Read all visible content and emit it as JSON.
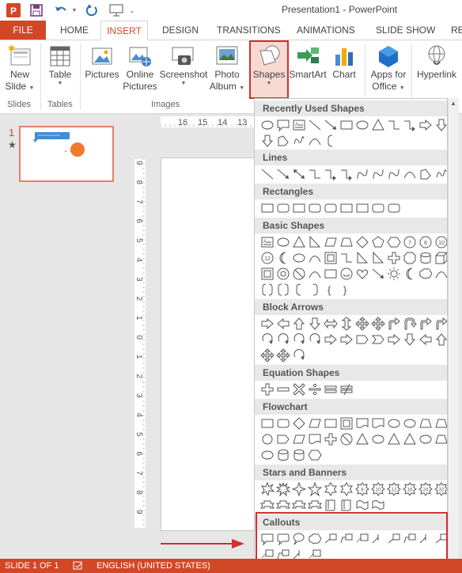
{
  "window": {
    "title": "Presentation1 - PowerPoint"
  },
  "tabs": [
    "FILE",
    "HOME",
    "INSERT",
    "DESIGN",
    "TRANSITIONS",
    "ANIMATIONS",
    "SLIDE SHOW",
    "RE"
  ],
  "ribbon": {
    "new_slide": [
      "New",
      "Slide"
    ],
    "table": "Table",
    "pictures": "Pictures",
    "online_pictures": [
      "Online",
      "Pictures"
    ],
    "screenshot": "Screenshot",
    "photo_album": [
      "Photo",
      "Album"
    ],
    "shapes": "Shapes",
    "smartart": "SmartArt",
    "chart": "Chart",
    "apps_office": [
      "Apps for",
      "Office"
    ],
    "hyperlink": "Hyperlink",
    "groups": {
      "slides": "Slides",
      "tables": "Tables",
      "images": "Images"
    }
  },
  "slides_pane": {
    "num": "1",
    "star": "★"
  },
  "ruler": {
    "ticks": [
      "16",
      "15",
      "14",
      "13"
    ],
    "vticks": [
      "9",
      "8",
      "7",
      "6",
      "5",
      "4",
      "3",
      "2",
      "1",
      "0",
      "1",
      "2",
      "3",
      "4",
      "5",
      "6",
      "7",
      "8",
      "9"
    ]
  },
  "dropdown": {
    "sections": [
      "Recently Used Shapes",
      "Lines",
      "Rectangles",
      "Basic Shapes",
      "Block Arrows",
      "Equation Shapes",
      "Flowchart",
      "Stars and Banners",
      "Callouts"
    ],
    "brace_glyphs": [
      "{",
      "}"
    ],
    "star_numbers": [
      "10",
      "12",
      "16",
      "24",
      "32"
    ]
  },
  "status": {
    "slide": "SLIDE 1 OF 1",
    "language": "ENGLISH (UNITED STATES)"
  }
}
